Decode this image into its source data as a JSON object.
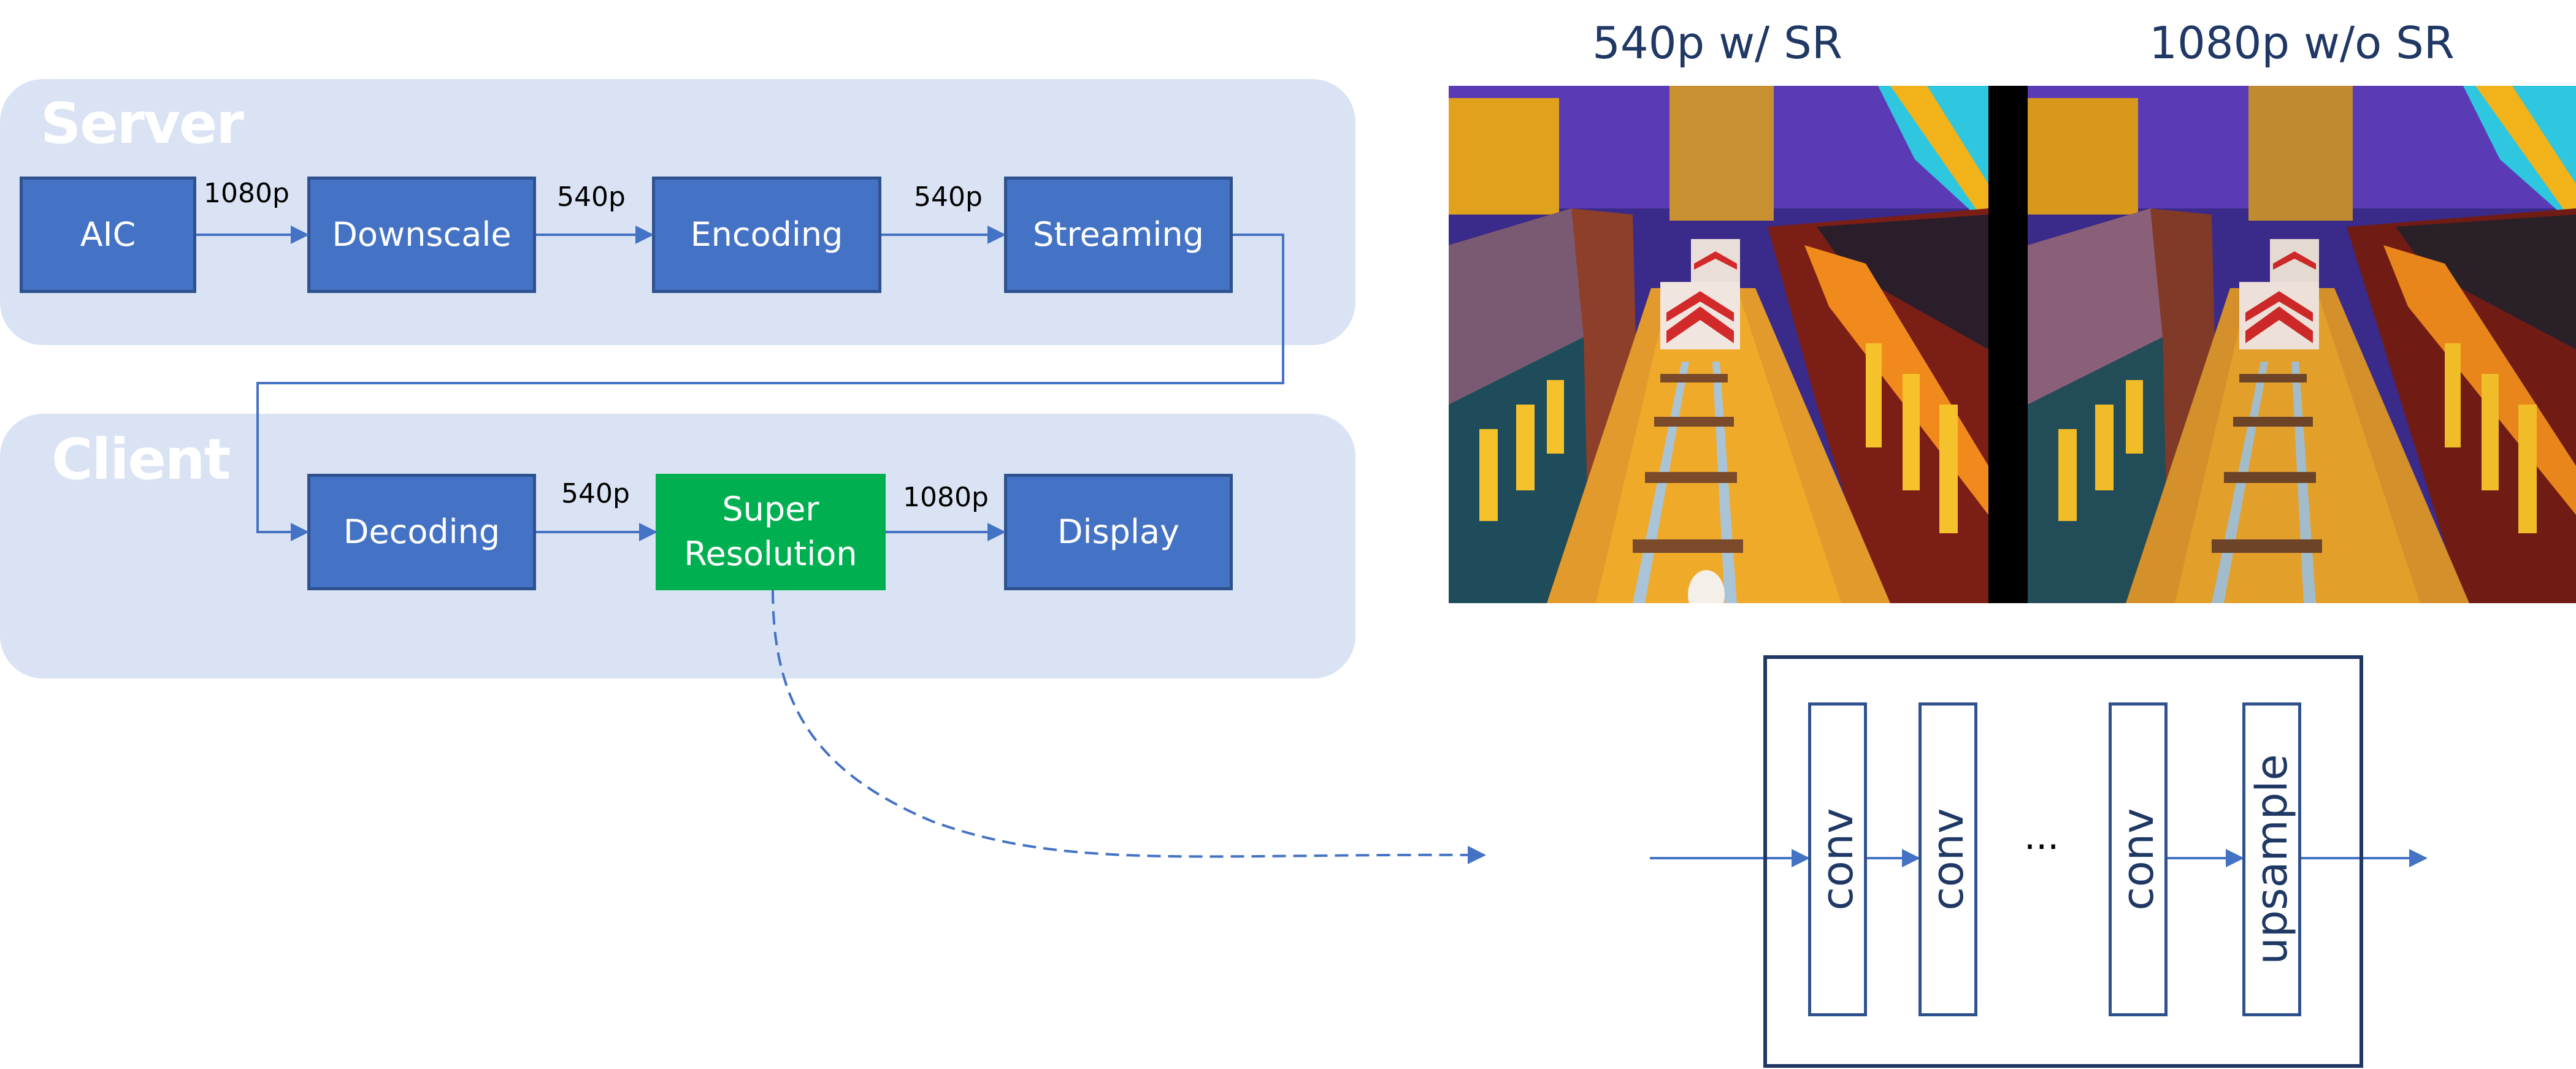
{
  "pipeline": {
    "server": {
      "title": "Server",
      "stages": [
        {
          "label": "AIC"
        },
        {
          "label": "Downscale"
        },
        {
          "label": "Encoding"
        },
        {
          "label": "Streaming"
        }
      ],
      "edge_labels": [
        "1080p",
        "540p",
        "540p"
      ]
    },
    "client": {
      "title": "Client",
      "stages": [
        {
          "label": "Decoding"
        },
        {
          "label": "Super\nResolution",
          "line1": "Super",
          "line2": "Resolution",
          "highlight": true
        },
        {
          "label": "Display"
        }
      ],
      "edge_labels": [
        "540p",
        "1080p"
      ]
    },
    "colors": {
      "panel_bg": "#dae3f3",
      "stage_fill": "#4472c4",
      "stage_border": "#2f528f",
      "highlight_fill": "#00b050",
      "arrow": "#4472c4",
      "title_text": "#1f3864"
    }
  },
  "comparison": {
    "left_title": "540p w/ SR",
    "right_title": "1080p w/o SR",
    "scene_description": "Endless-runner game frame: train tracks between two trains, barrier with red/white chevrons"
  },
  "network": {
    "layers": [
      "conv",
      "conv",
      "conv",
      "upsample"
    ],
    "ellipsis": "..."
  }
}
